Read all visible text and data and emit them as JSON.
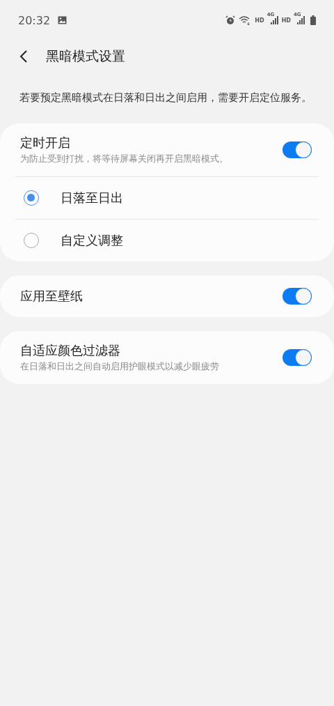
{
  "status_bar": {
    "time": "20:32",
    "networks": [
      {
        "label": "HD",
        "tech": "4G"
      },
      {
        "label": "HD",
        "tech": "4G"
      }
    ]
  },
  "header": {
    "title": "黑暗模式设置"
  },
  "description": "若要预定黑暗模式在日落和日出之间启用，需要开启定位服务。",
  "cards": [
    {
      "items": [
        {
          "kind": "switch",
          "title": "定时开启",
          "subtitle": "为防止受到打扰，将等待屏幕关闭再开启黑暗模式。",
          "on": true
        },
        {
          "kind": "radio",
          "title": "日落至日出",
          "selected": true
        },
        {
          "kind": "radio",
          "title": "自定义调整",
          "selected": false
        }
      ]
    },
    {
      "items": [
        {
          "kind": "switch",
          "title": "应用至壁纸",
          "on": true
        }
      ]
    },
    {
      "items": [
        {
          "kind": "switch",
          "title": "自适应颜色过滤器",
          "subtitle": "在日落和日出之间自动启用护眼模式以减少眼疲劳",
          "on": true
        }
      ]
    }
  ]
}
